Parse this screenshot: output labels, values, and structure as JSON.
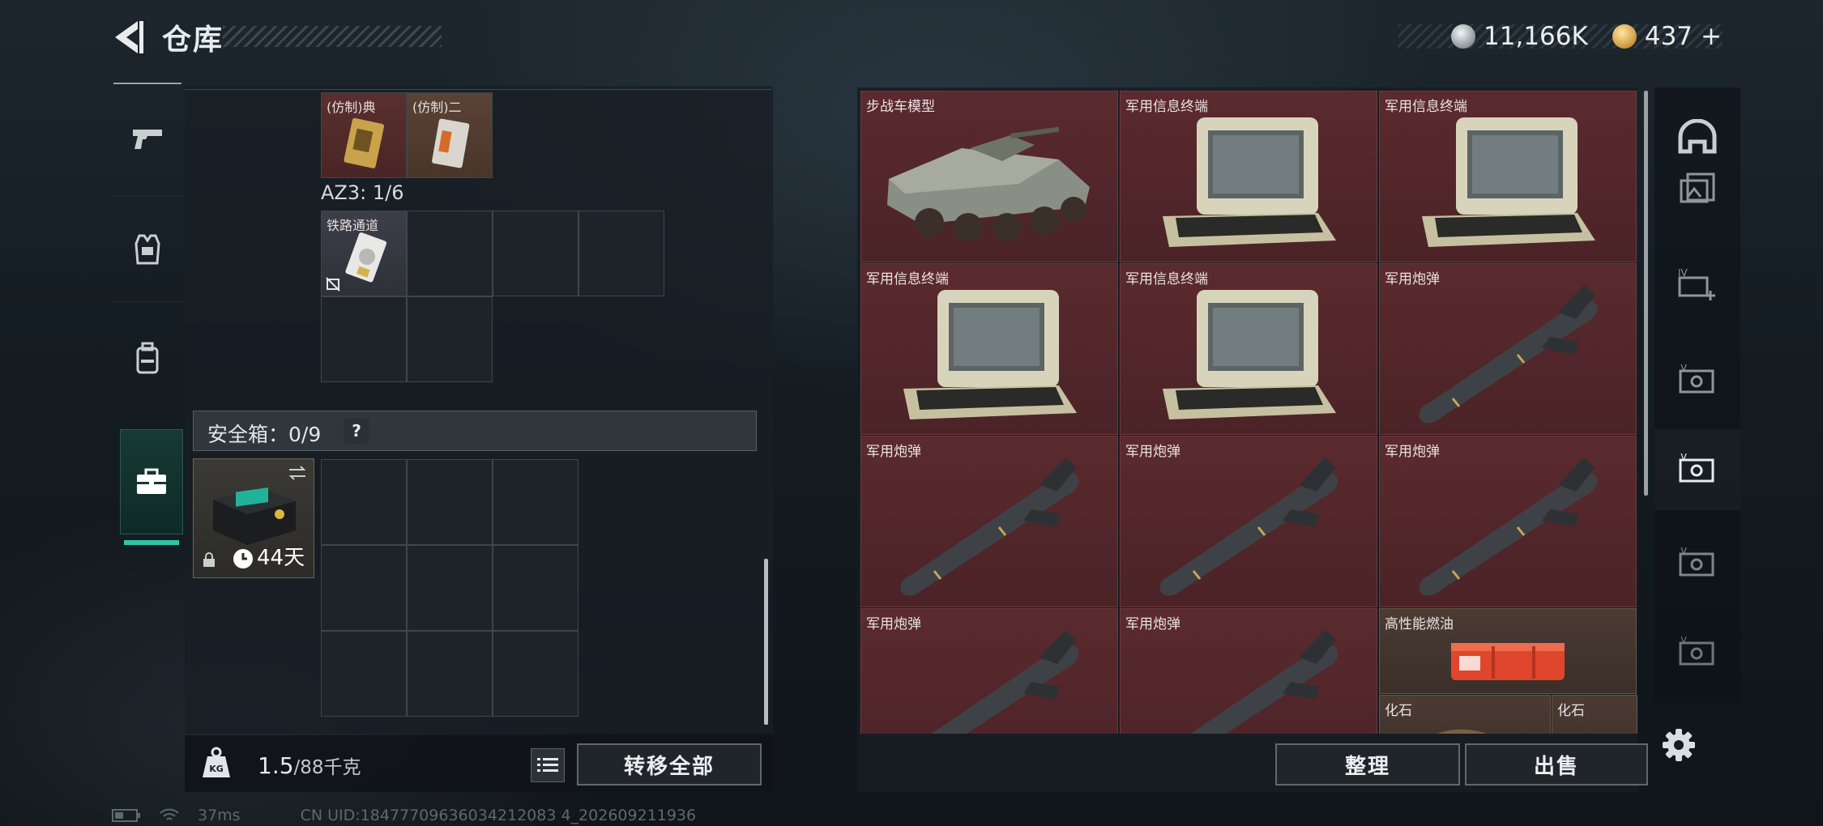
{
  "header": {
    "title": "仓库",
    "back_icon": "back-arrow-icon",
    "currency": {
      "silver_amount": "11,166K",
      "gold_amount": "437",
      "gold_plus": "+"
    }
  },
  "category_tabs": [
    {
      "icon": "pistol-icon",
      "active": false
    },
    {
      "icon": "armor-vest-icon",
      "active": false
    },
    {
      "icon": "backpack-icon",
      "active": false
    },
    {
      "icon": "briefcase-icon",
      "active": true
    }
  ],
  "inventory": {
    "top_items": [
      {
        "label": "(仿制)典",
        "color": "#5a2f2f"
      },
      {
        "label": "(仿制)二",
        "color": "#5a4235"
      }
    ],
    "az3_label": "AZ3: 1/6",
    "az3_items": [
      {
        "label": "铁路通道"
      }
    ],
    "safe_box": {
      "label": "安全箱：0/9",
      "help": "?",
      "duration": "44天"
    },
    "weight": {
      "current": "1.5",
      "max": "/88千克"
    },
    "transfer_all_label": "转移全部"
  },
  "storage": {
    "items": [
      {
        "label": "步战车模型",
        "type": "vehicle"
      },
      {
        "label": "军用信息终端",
        "type": "terminal"
      },
      {
        "label": "军用信息终端",
        "type": "terminal"
      },
      {
        "label": "军用信息终端",
        "type": "terminal"
      },
      {
        "label": "军用信息终端",
        "type": "terminal"
      },
      {
        "label": "军用炮弹",
        "type": "missile"
      },
      {
        "label": "军用炮弹",
        "type": "missile"
      },
      {
        "label": "军用炮弹",
        "type": "missile"
      },
      {
        "label": "军用炮弹",
        "type": "missile"
      },
      {
        "label": "军用炮弹",
        "type": "missile"
      },
      {
        "label": "军用炮弹",
        "type": "missile"
      },
      {
        "label": "高性能燃油",
        "type": "fuel"
      }
    ],
    "fossil_labels": [
      "化石",
      "化石"
    ],
    "sort_label": "整理",
    "sell_label": "出售"
  },
  "filters": [
    {
      "icon": "helmet-icon"
    },
    {
      "icon": "gift-card-icon"
    },
    {
      "icon": "card-add-icon"
    },
    {
      "icon": "coupon-icon"
    },
    {
      "icon": "coupon-selected-icon"
    },
    {
      "icon": "coupon-icon"
    },
    {
      "icon": "coupon-icon"
    }
  ],
  "footer": {
    "ping": "37ms",
    "uid": "CN UID:18477709636034212083 4_202609211936"
  },
  "colors": {
    "accent": "#2fc6a6",
    "item_red": "#5a2a2e",
    "item_brown": "#4a3b33"
  }
}
